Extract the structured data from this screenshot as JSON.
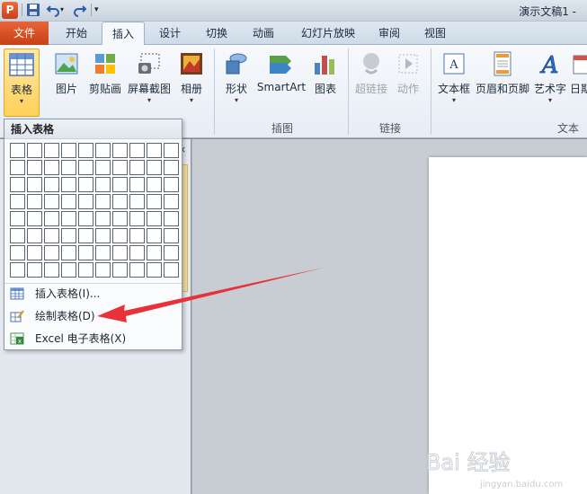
{
  "window": {
    "title": "演示文稿1 -",
    "app_icon": "P"
  },
  "tabs": {
    "file": "文件",
    "items": [
      "开始",
      "插入",
      "设计",
      "切换",
      "动画",
      "幻灯片放映",
      "审阅",
      "视图"
    ],
    "active": "插入"
  },
  "ribbon": {
    "buttons": [
      {
        "label": "表格",
        "icon": "table-icon",
        "has_arrow": true
      },
      {
        "label": "图片",
        "icon": "picture-icon"
      },
      {
        "label": "剪贴画",
        "icon": "clipart-icon"
      },
      {
        "label": "屏幕截图",
        "icon": "screenshot-icon",
        "has_arrow": true
      },
      {
        "label": "相册",
        "icon": "album-icon",
        "has_arrow": true
      },
      {
        "label": "形状",
        "icon": "shapes-icon",
        "has_arrow": true
      },
      {
        "label": "SmartArt",
        "icon": "smartart-icon"
      },
      {
        "label": "图表",
        "icon": "chart-icon"
      },
      {
        "label": "超链接",
        "icon": "hyperlink-icon",
        "disabled": true
      },
      {
        "label": "动作",
        "icon": "action-icon",
        "disabled": true
      },
      {
        "label": "文本框",
        "icon": "textbox-icon",
        "has_arrow": true
      },
      {
        "label": "页眉和页脚",
        "icon": "header-footer-icon"
      },
      {
        "label": "艺术字",
        "icon": "wordart-icon",
        "has_arrow": true
      },
      {
        "label": "日期",
        "icon": "date-icon"
      }
    ],
    "groups": {
      "illustrations": "插图",
      "links": "链接",
      "text": "文本"
    }
  },
  "dropdown": {
    "header": "插入表格",
    "grid_rows": 8,
    "grid_cols": 10,
    "items": [
      {
        "label": "插入表格(I)...",
        "icon": "insert-table-icon"
      },
      {
        "label": "绘制表格(D)",
        "icon": "draw-table-icon"
      },
      {
        "label": "Excel 电子表格(X)",
        "icon": "excel-sheet-icon"
      }
    ]
  },
  "workspace": {
    "pane_close": "×"
  },
  "watermark": {
    "brand": "Bai 经验",
    "url": "jingyan.baidu.com"
  },
  "colors": {
    "accent_file_tab": "#d04e20",
    "arrow": "#e8323a",
    "selected_button": "#ffd05a"
  }
}
